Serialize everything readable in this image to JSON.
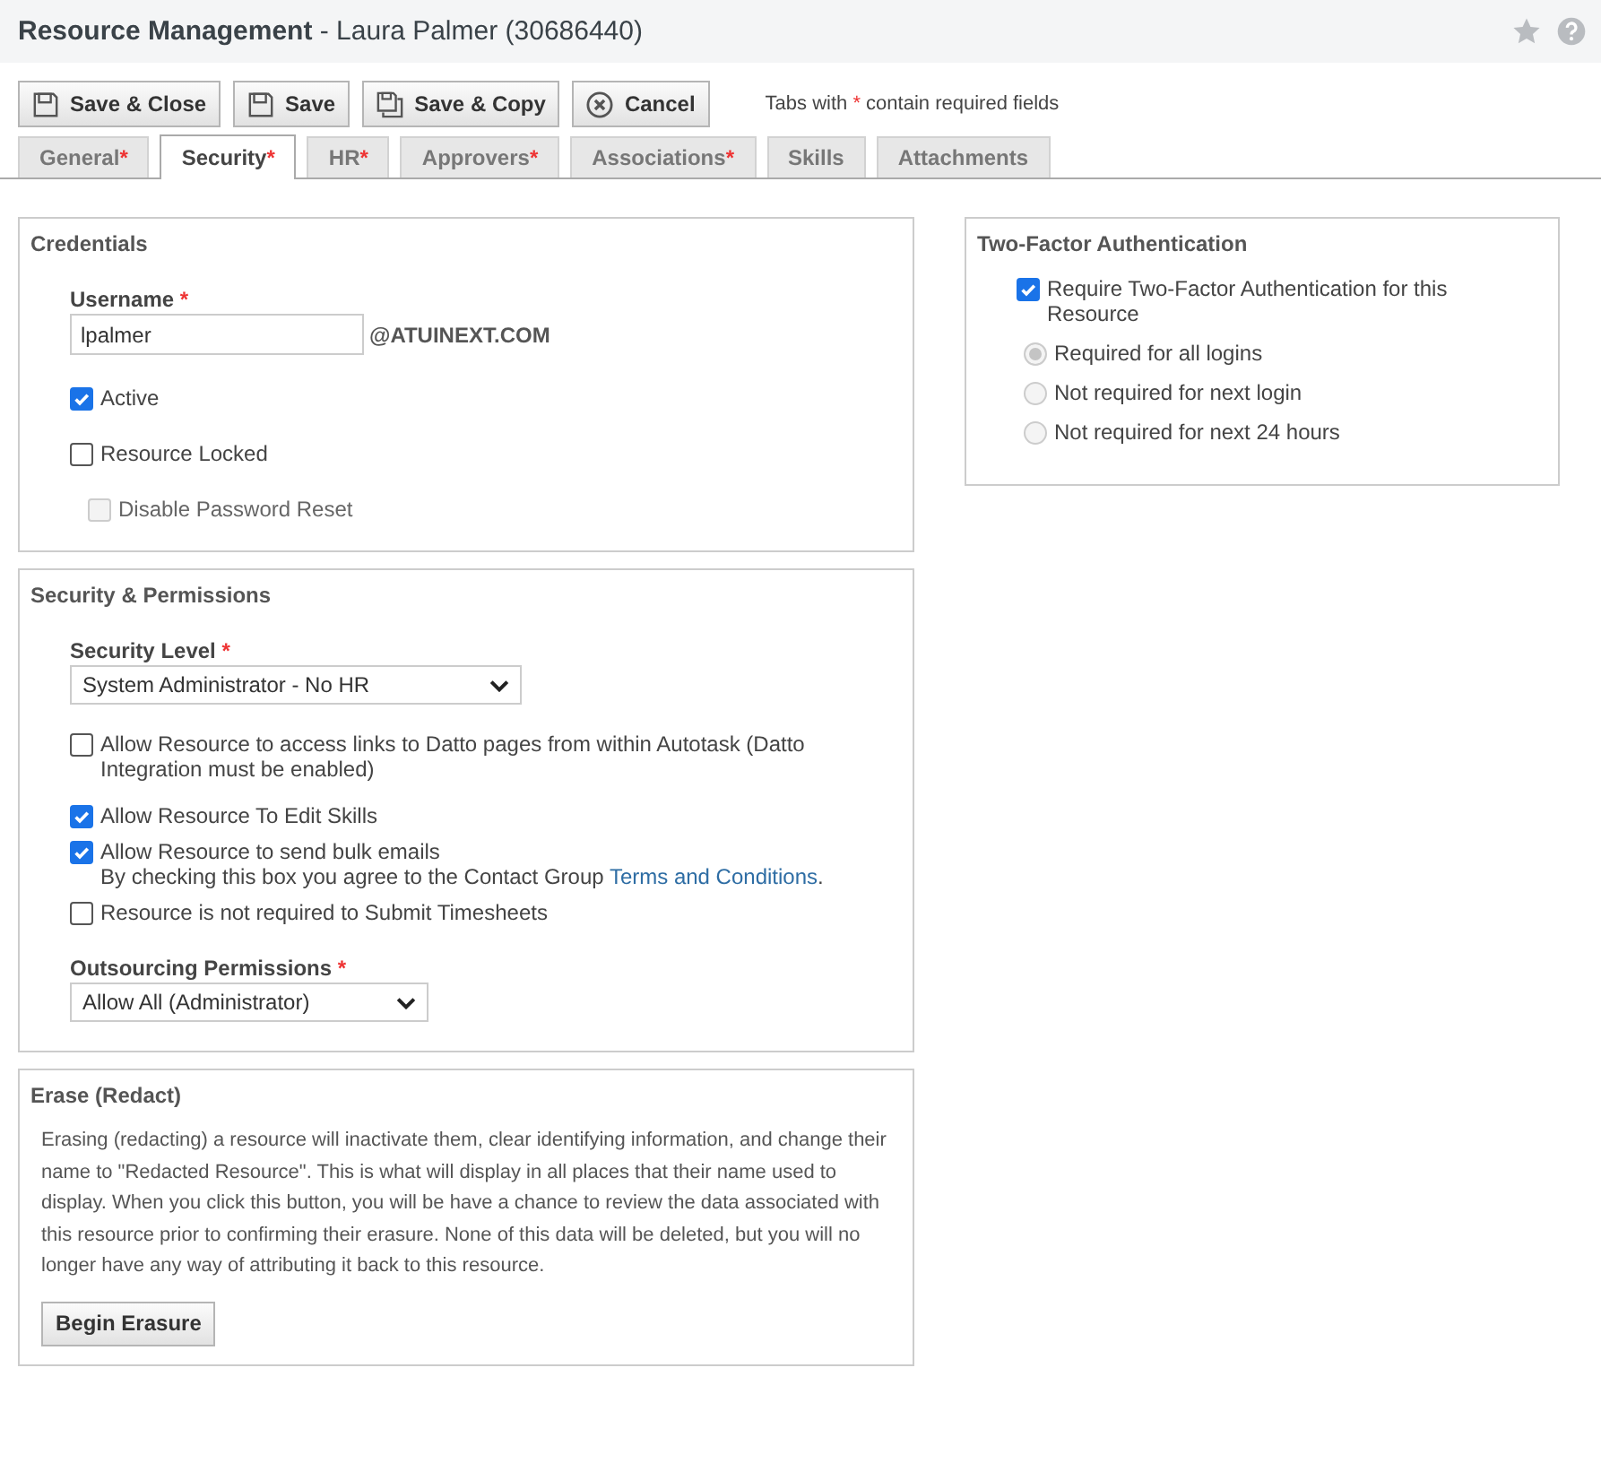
{
  "header": {
    "title": "Resource Management",
    "subtitle": "- Laura Palmer (30686440)"
  },
  "toolbar": {
    "buttons": [
      {
        "label": "Save & Close"
      },
      {
        "label": "Save"
      },
      {
        "label": "Save & Copy"
      },
      {
        "label": "Cancel"
      }
    ],
    "note": {
      "before": "Tabs with",
      "mark": "*",
      "after": "contain required fields"
    }
  },
  "tabs": [
    {
      "label": "General",
      "mark": "*",
      "selected": false
    },
    {
      "label": "Security",
      "mark": "*",
      "selected": true
    },
    {
      "label": "HR",
      "mark": "*",
      "selected": false
    },
    {
      "label": "Approvers",
      "mark": "*",
      "selected": false
    },
    {
      "label": "Associations",
      "mark": "*",
      "selected": false
    },
    {
      "label": "Skills",
      "selected": false
    },
    {
      "label": "Attachments",
      "selected": false
    }
  ],
  "credentials": {
    "title": "Credentials",
    "username_label": "Username",
    "username_mark": "*",
    "username": "lpalmer",
    "domain": "@ATUINEXT.COM",
    "checkboxes": [
      {
        "label": "Active",
        "checked": true,
        "disabled": false
      },
      {
        "label": "Resource Locked",
        "checked": false,
        "disabled": false
      },
      {
        "label": "Disable Password Reset",
        "checked": false,
        "disabled": true
      }
    ]
  },
  "permissions": {
    "title": "Security & Permissions",
    "security_level_label": "Security Level",
    "security_level_mark": "*",
    "security_level": "System Administrator - No HR",
    "checkboxes": [
      {
        "label": "Allow Resource to access links to Datto pages from within Autotask (Datto Integration must be enabled)",
        "checked": false
      },
      {
        "label": "Allow Resource To Edit Skills",
        "checked": true
      },
      {
        "label": "Allow Resource to send bulk emails",
        "checked": true,
        "note": "By checking this box you agree to the Contact Group",
        "link": "Terms and Conditions",
        "after": "."
      },
      {
        "label": "Resource is not required to Submit Timesheets",
        "checked": false
      }
    ],
    "outsourcing_label": "Outsourcing Permissions",
    "outsourcing_mark": "*",
    "outsourcing": "Allow All (Administrator)"
  },
  "erase": {
    "title": "Erase (Redact)",
    "text": "Erasing (redacting) a resource will inactivate them, clear identifying information, and change their name to \"Redacted Resource\". This is what will display in all places that their name used to display. When you click this button, you will be have a chance to review the data associated with this resource prior to confirming their erasure. None of this data will be deleted, but you will no longer have any way of attributing it back to this resource.",
    "button": "Begin Erasure"
  },
  "two_factor": {
    "title": "Two-Factor Authentication",
    "require_label": "Require Two-Factor Authentication for this Resource",
    "require_checked": true,
    "options": [
      {
        "label": "Required for all logins",
        "selected": true,
        "disabled": true
      },
      {
        "label": "Not required for next login",
        "selected": false,
        "disabled": true
      },
      {
        "label": "Not required for next 24 hours",
        "selected": false,
        "disabled": true
      }
    ]
  }
}
